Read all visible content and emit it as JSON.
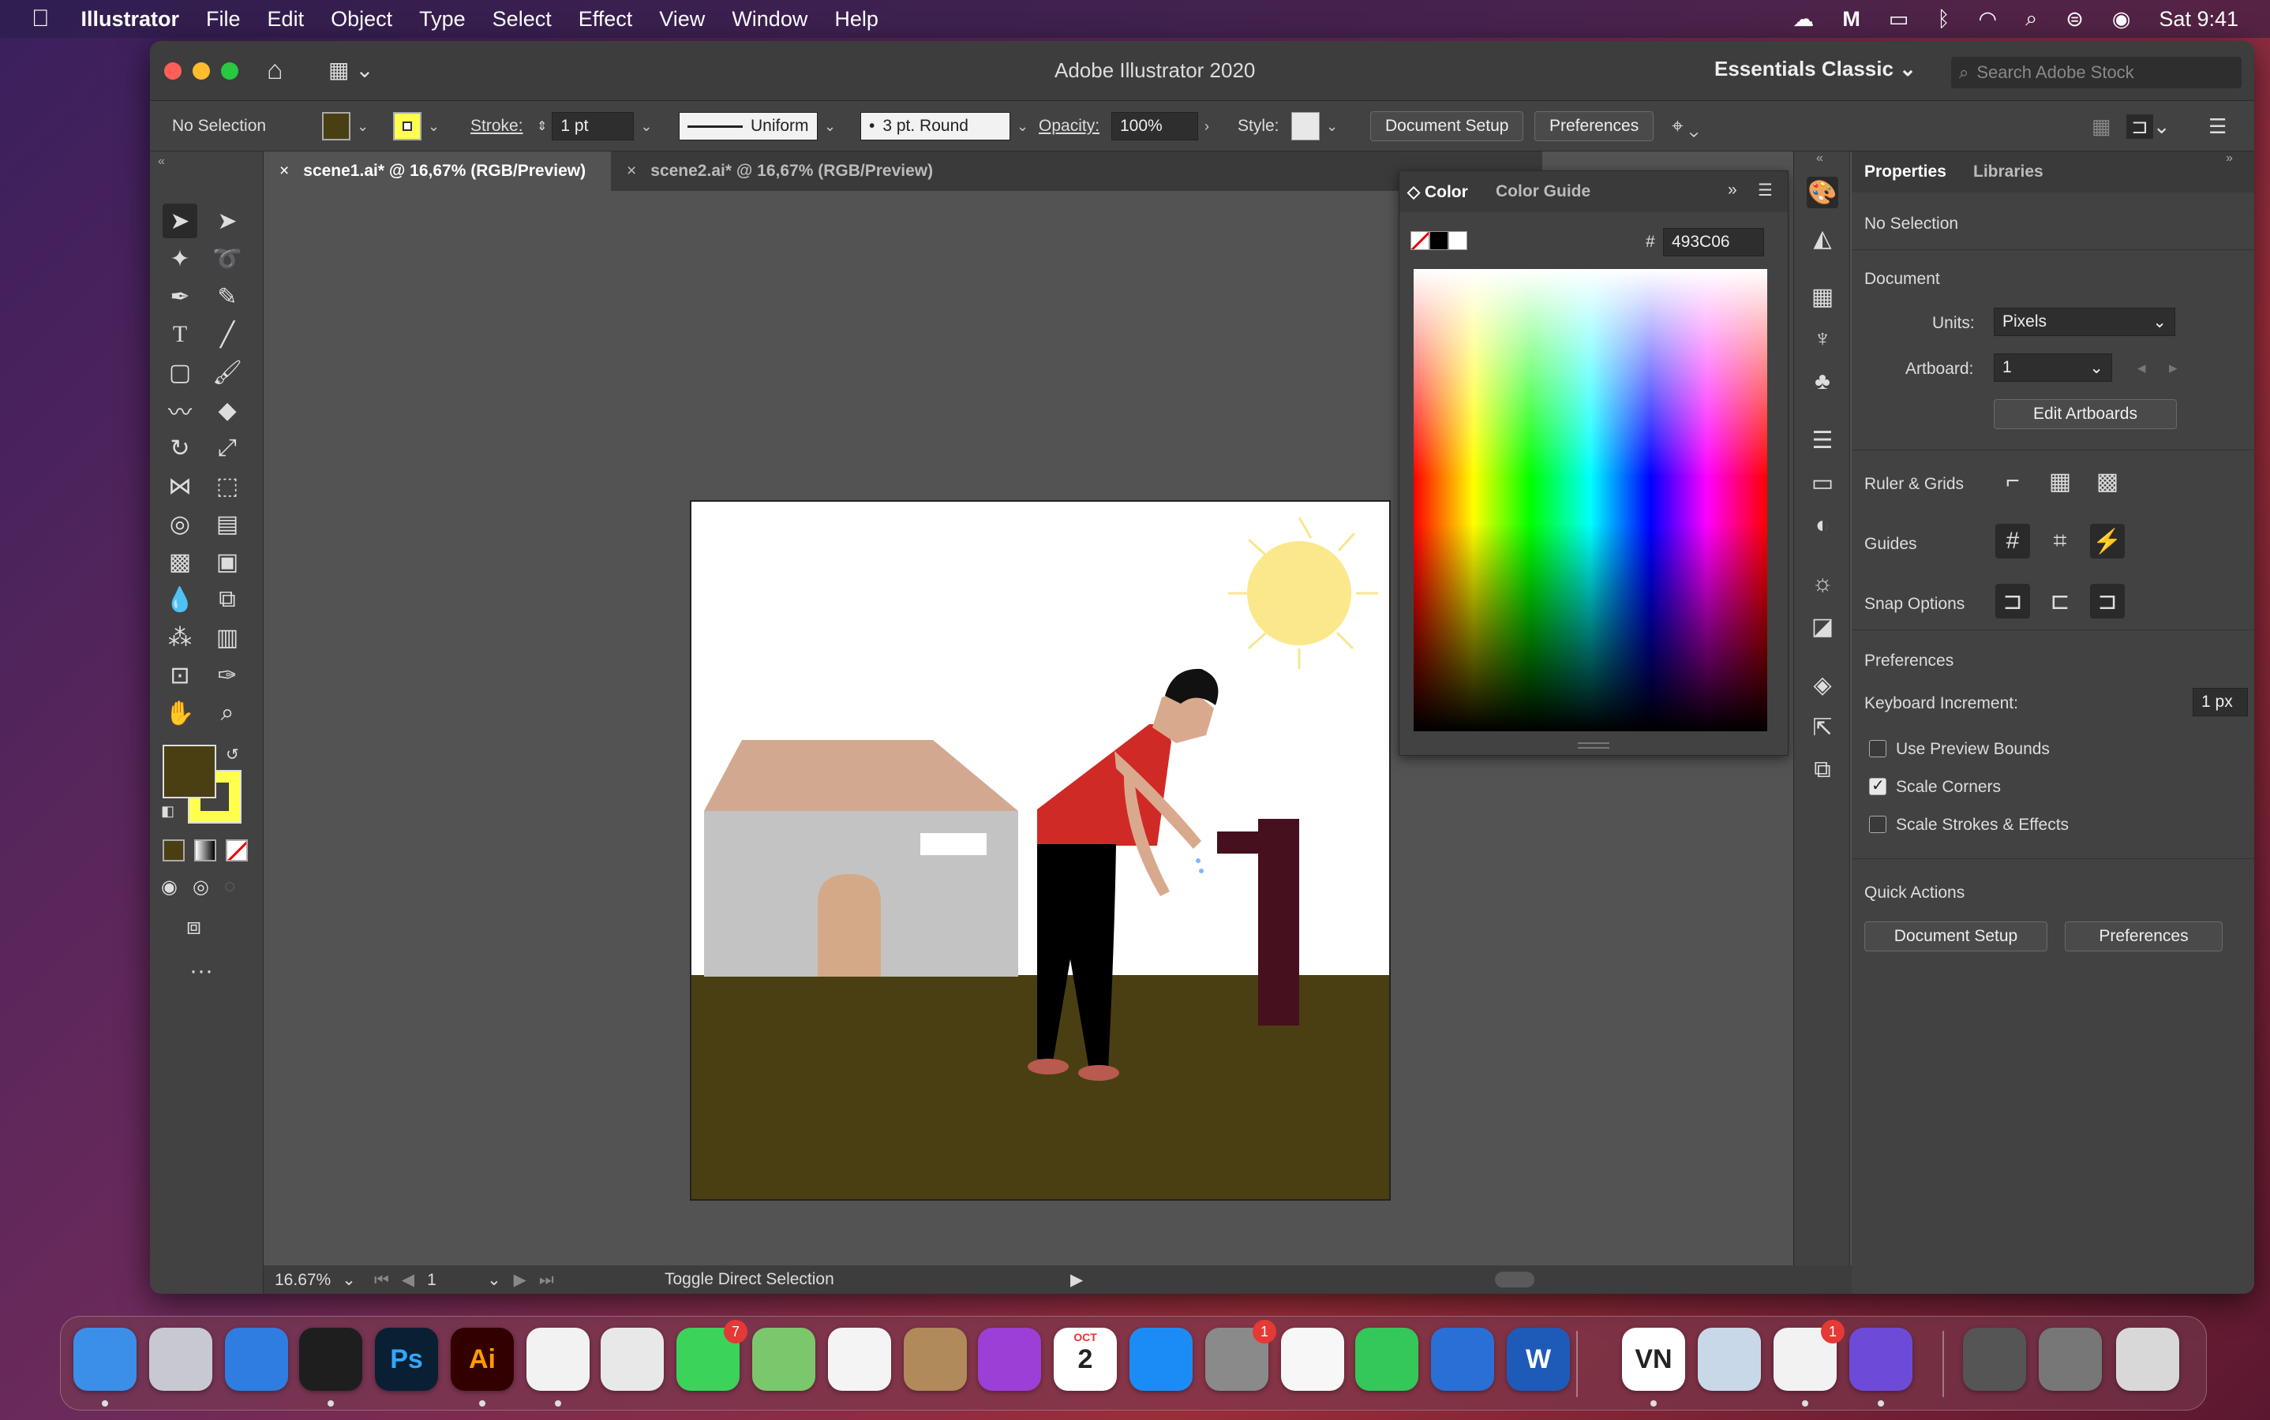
{
  "menubar": {
    "app_name": "Illustrator",
    "items": [
      "File",
      "Edit",
      "Object",
      "Type",
      "Select",
      "Effect",
      "View",
      "Window",
      "Help"
    ],
    "clock": "Sat 9:41"
  },
  "window": {
    "title": "Adobe Illustrator 2020",
    "workspace": "Essentials Classic",
    "search_placeholder": "Search Adobe Stock"
  },
  "control_bar": {
    "selection": "No Selection",
    "stroke_label": "Stroke:",
    "stroke_value": "1 pt",
    "profile": "Uniform",
    "brush": "3 pt. Round",
    "opacity_label": "Opacity:",
    "opacity_value": "100%",
    "style_label": "Style:",
    "document_setup": "Document Setup",
    "preferences": "Preferences",
    "fill_color": "#4a3f12",
    "stroke_color": "#ffff4d"
  },
  "tabs": [
    {
      "label": "scene1.ai* @ 16,67% (RGB/Preview)",
      "active": true
    },
    {
      "label": "scene2.ai* @ 16,67% (RGB/Preview)",
      "active": false
    }
  ],
  "status": {
    "zoom": "16.67%",
    "artboard": "1",
    "tool_hint": "Toggle Direct Selection"
  },
  "color_panel": {
    "tab_color": "Color",
    "tab_guide": "Color Guide",
    "hash": "#",
    "hex": "493C06"
  },
  "properties": {
    "tab_properties": "Properties",
    "tab_libraries": "Libraries",
    "selection": "No Selection",
    "document": "Document",
    "units_label": "Units:",
    "units_value": "Pixels",
    "artboard_label": "Artboard:",
    "artboard_value": "1",
    "edit_artboards": "Edit Artboards",
    "ruler_grids": "Ruler & Grids",
    "guides": "Guides",
    "snap_options": "Snap Options",
    "preferences": "Preferences",
    "keyboard_increment_label": "Keyboard Increment:",
    "keyboard_increment_value": "1 px",
    "use_preview_bounds": "Use Preview Bounds",
    "scale_corners": "Scale Corners",
    "scale_strokes": "Scale Strokes & Effects",
    "quick_actions": "Quick Actions",
    "qa_document_setup": "Document Setup",
    "qa_preferences": "Preferences"
  },
  "dock": {
    "apps": [
      {
        "name": "finder",
        "label": "",
        "color": "#3b8fe8"
      },
      {
        "name": "launchpad",
        "label": "",
        "color": "#c8c8d0"
      },
      {
        "name": "safari",
        "label": "",
        "color": "#2f7de0"
      },
      {
        "name": "figma",
        "label": "",
        "color": "#1e1e1e"
      },
      {
        "name": "photoshop",
        "label": "Ps",
        "color": "#0a1f33"
      },
      {
        "name": "illustrator",
        "label": "Ai",
        "color": "#330000"
      },
      {
        "name": "chrome",
        "label": "",
        "color": "#f2f2f2"
      },
      {
        "name": "blender",
        "label": "",
        "color": "#e8e8e8"
      },
      {
        "name": "messages",
        "label": "",
        "color": "#3cd35a",
        "badge": "7"
      },
      {
        "name": "maps",
        "label": "",
        "color": "#7bc86c"
      },
      {
        "name": "photos",
        "label": "",
        "color": "#f4f4f4"
      },
      {
        "name": "contacts",
        "label": "",
        "color": "#b08a5a"
      },
      {
        "name": "podcasts",
        "label": "",
        "color": "#9b3fd6"
      },
      {
        "name": "calendar",
        "label": "2",
        "color": "#ffffff",
        "month": "OCT"
      },
      {
        "name": "app-store",
        "label": "",
        "color": "#1b8cf5"
      },
      {
        "name": "system-preferences",
        "label": "",
        "color": "#8a8a8a",
        "badge": "1"
      },
      {
        "name": "reminders",
        "label": "",
        "color": "#f7f7f7"
      },
      {
        "name": "facetime",
        "label": "",
        "color": "#34c759"
      },
      {
        "name": "quicktime",
        "label": "",
        "color": "#2a6fd6"
      },
      {
        "name": "word",
        "label": "W",
        "color": "#1e5bb8"
      },
      {
        "name": "vn",
        "label": "VN",
        "color": "#ffffff"
      },
      {
        "name": "preview",
        "label": "",
        "color": "#c9d8e8"
      },
      {
        "name": "microsoft-office",
        "label": "",
        "color": "#f2f2f2",
        "badge": "1"
      },
      {
        "name": "imovie",
        "label": "",
        "color": "#6d4bd8"
      },
      {
        "name": "screenshot-1",
        "label": "",
        "color": "#555"
      },
      {
        "name": "screenshot-2",
        "label": "",
        "color": "#777"
      },
      {
        "name": "trash",
        "label": "",
        "color": "#d8d8d8"
      }
    ]
  }
}
